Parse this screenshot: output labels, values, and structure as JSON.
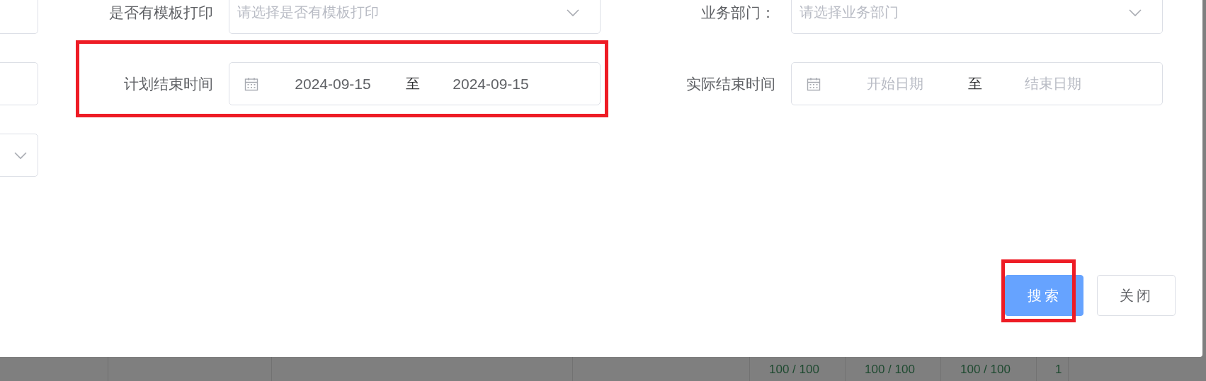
{
  "left_column": {
    "fields": [
      {
        "kind": "input"
      },
      {
        "kind": "input"
      },
      {
        "kind": "select"
      }
    ]
  },
  "form": {
    "rows": [
      {
        "fields": [
          {
            "kind": "select",
            "label": "是否有模板打印",
            "placeholder": "请选择是否有模板打印",
            "highlighted": false
          },
          {
            "kind": "select",
            "label": "业务部门：",
            "placeholder": "请选择业务部门",
            "highlighted": false
          }
        ]
      },
      {
        "fields": [
          {
            "kind": "date_range",
            "label": "计划结束时间",
            "start": "2024-09-15",
            "separator": "至",
            "end": "2024-09-15",
            "highlighted": true
          },
          {
            "kind": "date_range",
            "label": "实际结束时间",
            "start_placeholder": "开始日期",
            "separator": "至",
            "end_placeholder": "结束日期",
            "highlighted": false
          }
        ]
      }
    ]
  },
  "buttons": [
    {
      "kind": "primary",
      "label": "搜索",
      "highlighted": true
    },
    {
      "kind": "default",
      "label": "关闭",
      "highlighted": false
    }
  ],
  "background_table": {
    "cells": [
      "100 / 100",
      "100 / 100",
      "100 / 100",
      "1"
    ]
  }
}
